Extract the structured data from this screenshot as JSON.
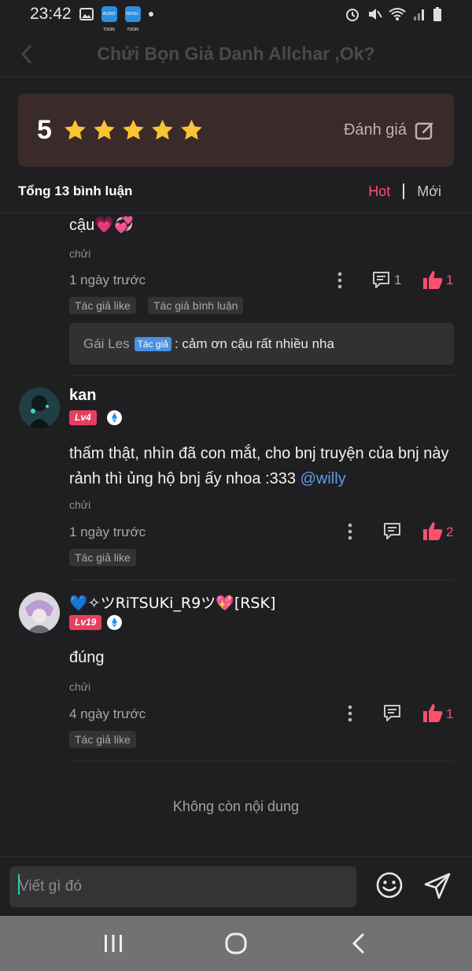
{
  "status_bar": {
    "time": "23:42",
    "app1": "AUDIO TOON",
    "app2": "NOVEL TOON"
  },
  "header": {
    "title": "Chửi Bọn Giả Danh Allchar ,Ok?"
  },
  "rating": {
    "score": "5",
    "stars": 5,
    "action_label": "Đánh giá"
  },
  "comments_bar": {
    "total": "Tổng 13 bình luận",
    "sort_hot": "Hot",
    "sort_new": "Mới"
  },
  "comments": [
    {
      "text": "cậu💗💞",
      "category": "chửi",
      "time": "1 ngày trước",
      "reply_count": "1",
      "like_count": "1",
      "tags": [
        "Tác giả like",
        "Tác giả bình luận"
      ],
      "author_reply": {
        "name": "Gái Les",
        "badge": "Tác giả",
        "text": ": cảm ơn cậu rất nhiều nha"
      }
    },
    {
      "username": "kan",
      "level": "Lv4",
      "text_line1": "thấm thật, nhìn đã con mắt, cho bnj truyện của bnj này",
      "text_line2": "rảnh thì ủng hộ bnj ấy nhoa :333 ",
      "mention": "@willy",
      "category": "chửi",
      "time": "1 ngày trước",
      "like_count": "2",
      "tags": [
        "Tác giả like"
      ]
    },
    {
      "username": "💙✧ツRiTSUKi_R9ツ💖[RSK]",
      "level": "Lv19",
      "text": "đúng",
      "category": "chửi",
      "time": "4 ngày trước",
      "like_count": "1",
      "tags": [
        "Tác giả like"
      ]
    }
  ],
  "end_text": "Không còn nội dung",
  "input": {
    "placeholder": "Viết gì đó"
  },
  "colors": {
    "accent": "#ff4f6d",
    "background": "#1f1f21",
    "card": "#3b2a2a",
    "star": "#f7c531",
    "mention": "#5a9eea"
  }
}
